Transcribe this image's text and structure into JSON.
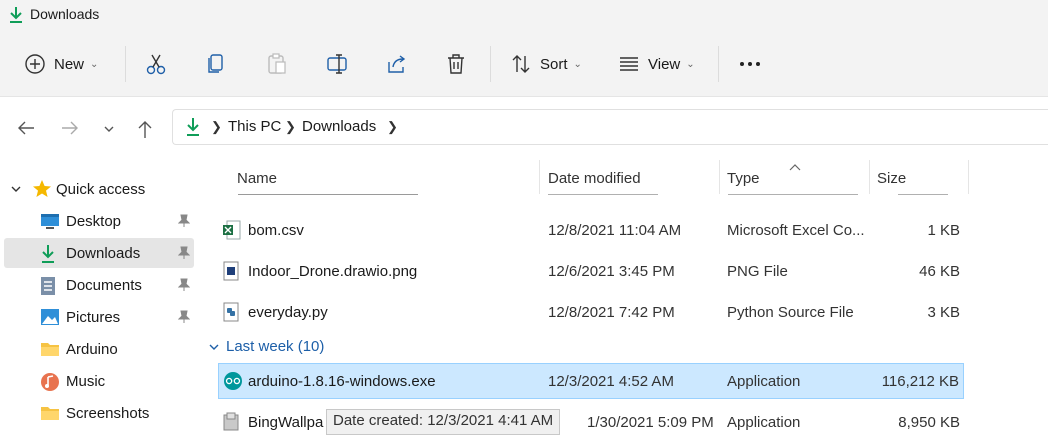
{
  "window": {
    "title": "Downloads"
  },
  "toolbar": {
    "new_label": "New",
    "sort_label": "Sort",
    "view_label": "View",
    "icons": [
      "plus-icon",
      "cut-icon",
      "copy-icon",
      "paste-icon",
      "rename-icon",
      "share-icon",
      "delete-icon",
      "sort-icon",
      "view-icon",
      "more-icon"
    ]
  },
  "address": {
    "crumbs": [
      "This PC",
      "Downloads"
    ]
  },
  "sidebar": {
    "items": [
      {
        "label": "Quick access",
        "icon": "star-icon"
      },
      {
        "label": "Desktop",
        "icon": "desktop-icon",
        "pinned": true
      },
      {
        "label": "Downloads",
        "icon": "download-icon",
        "pinned": true,
        "selected": true
      },
      {
        "label": "Documents",
        "icon": "document-icon",
        "pinned": true
      },
      {
        "label": "Pictures",
        "icon": "pictures-icon",
        "pinned": true
      },
      {
        "label": "Arduino",
        "icon": "folder-icon"
      },
      {
        "label": "Music",
        "icon": "music-icon"
      },
      {
        "label": "Screenshots",
        "icon": "folder-icon"
      }
    ]
  },
  "columns": {
    "name": "Name",
    "date": "Date modified",
    "type": "Type",
    "size": "Size"
  },
  "files": [
    {
      "name": "bom.csv",
      "date": "12/8/2021 11:04 AM",
      "type": "Microsoft Excel Co...",
      "size": "1 KB",
      "icon": "excel-file-icon"
    },
    {
      "name": "Indoor_Drone.drawio.png",
      "date": "12/6/2021 3:45 PM",
      "type": "PNG File",
      "size": "46 KB",
      "icon": "image-file-icon"
    },
    {
      "name": "everyday.py",
      "date": "12/8/2021 7:42 PM",
      "type": "Python Source File",
      "size": "3 KB",
      "icon": "python-file-icon"
    }
  ],
  "group": {
    "label": "Last week (10)"
  },
  "group_files": [
    {
      "name": "arduino-1.8.16-windows.exe",
      "date": "12/3/2021 4:52 AM",
      "type": "Application",
      "size": "116,212 KB",
      "icon": "arduino-app-icon",
      "selected": true
    },
    {
      "name": "BingWallpa",
      "date": "1/30/2021 5:09 PM",
      "type": "Application",
      "size": "8,950 KB",
      "icon": "installer-app-icon"
    }
  ],
  "tooltip": {
    "text": "Date created: 12/3/2021 4:41 AM"
  },
  "colors": {
    "accent": "#0f9d58",
    "selected_row": "#cce8ff",
    "selected_sidebar": "#e5e5e5",
    "link": "#1d5fa8"
  }
}
